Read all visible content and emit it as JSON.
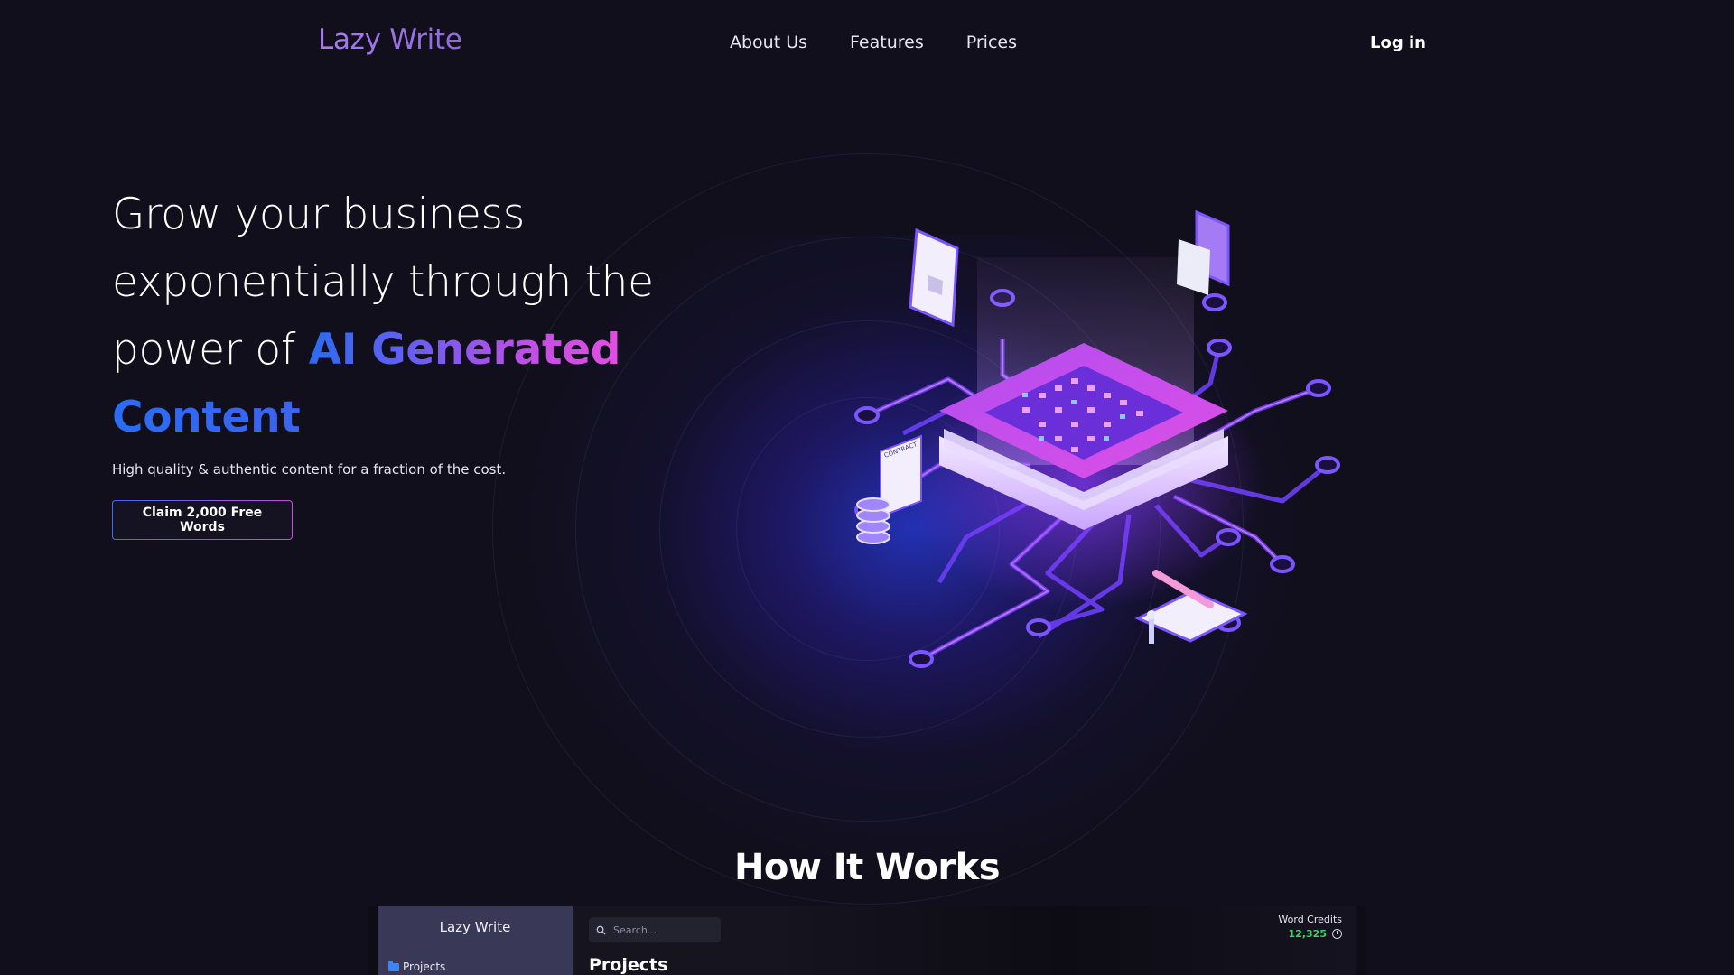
{
  "header": {
    "logo": "Lazy Write",
    "nav": [
      "About Us",
      "Features",
      "Prices"
    ],
    "login": "Log in"
  },
  "hero": {
    "title_part1": "Grow your business exponentially through the power of ",
    "title_highlight1": "AI Generated",
    "title_highlight2": "Content",
    "subtitle": "High quality & authentic content for a fraction of the cost.",
    "cta": "Claim 2,000 Free Words",
    "illustration_labels": [
      "CONTRACT"
    ]
  },
  "how_it_works": {
    "title": "How It Works",
    "app": {
      "logo": "Lazy Write",
      "sidebar_item": "Projects",
      "search_placeholder": "Search...",
      "page_title": "Projects",
      "credits_label": "Word Credits",
      "credits_value": "12,325"
    }
  },
  "colors": {
    "background": "#110f1b",
    "accent_blue": "#2b6cf0",
    "accent_purple": "#c14fe6",
    "logo": "#9b74e6",
    "credits_green": "#34d46a"
  }
}
